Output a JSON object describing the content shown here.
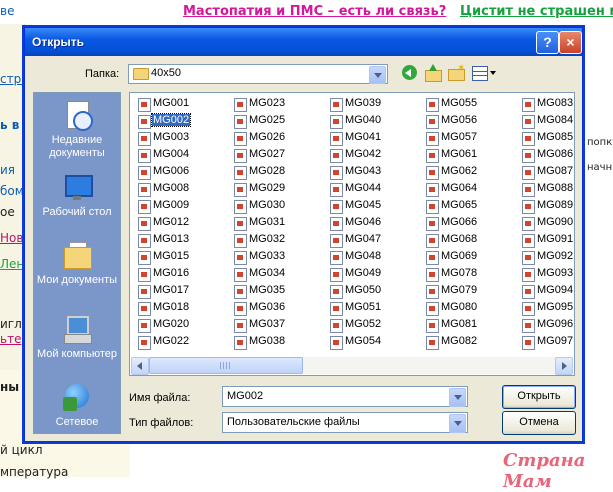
{
  "background": {
    "top_left": "ве",
    "link_pink": "Мастопатия и ПМС – есть ли связь?",
    "link_green": "Цистит не страшен ма",
    "left_fragments": [
      "стра",
      "ь в",
      "ия",
      "бом",
      "ое",
      "Нов",
      "Лен",
      "игла",
      "ьте",
      "ны",
      "й цикл",
      "мпература"
    ],
    "right_fragments": [
      "попку",
      "начн"
    ],
    "watermark": "Страна Мам"
  },
  "dialog": {
    "title": "Открыть",
    "help_button": "?",
    "close_button": "×",
    "folder_label": "Папка:",
    "folder_value": "40x50",
    "places": [
      {
        "label": "Недавние документы",
        "icon": "recent-documents-icon"
      },
      {
        "label": "Рабочий стол",
        "icon": "desktop-icon"
      },
      {
        "label": "Мои документы",
        "icon": "my-documents-icon"
      },
      {
        "label": "Мой компьютер",
        "icon": "my-computer-icon"
      },
      {
        "label": "Сетевое",
        "icon": "network-icon"
      }
    ],
    "file_columns": [
      [
        "MG001",
        "MG002",
        "MG003",
        "MG004",
        "MG006",
        "MG008",
        "MG009",
        "MG012",
        "MG013",
        "MG015",
        "MG016",
        "MG017",
        "MG018",
        "MG020",
        "MG022"
      ],
      [
        "MG023",
        "MG025",
        "MG026",
        "MG027",
        "MG028",
        "MG029",
        "MG030",
        "MG031",
        "MG032",
        "MG033",
        "MG034",
        "MG035",
        "MG036",
        "MG037",
        "MG038"
      ],
      [
        "MG039",
        "MG040",
        "MG041",
        "MG042",
        "MG043",
        "MG044",
        "MG045",
        "MG046",
        "MG047",
        "MG048",
        "MG049",
        "MG050",
        "MG051",
        "MG052",
        "MG054"
      ],
      [
        "MG055",
        "MG056",
        "MG057",
        "MG061",
        "MG062",
        "MG064",
        "MG065",
        "MG066",
        "MG068",
        "MG069",
        "MG078",
        "MG079",
        "MG080",
        "MG081",
        "MG082"
      ],
      [
        "MG083",
        "MG084",
        "MG085",
        "MG086",
        "MG087",
        "MG088",
        "MG089",
        "MG090",
        "MG091",
        "MG092",
        "MG093",
        "MG094",
        "MG095",
        "MG096",
        "MG097"
      ]
    ],
    "selected_file": "MG002",
    "filename_label": "Имя файла:",
    "filename_value": "MG002",
    "filetype_label": "Тип файлов:",
    "filetype_value": "Пользовательские файлы",
    "open_button": "Открыть",
    "cancel_button": "Отмена"
  }
}
